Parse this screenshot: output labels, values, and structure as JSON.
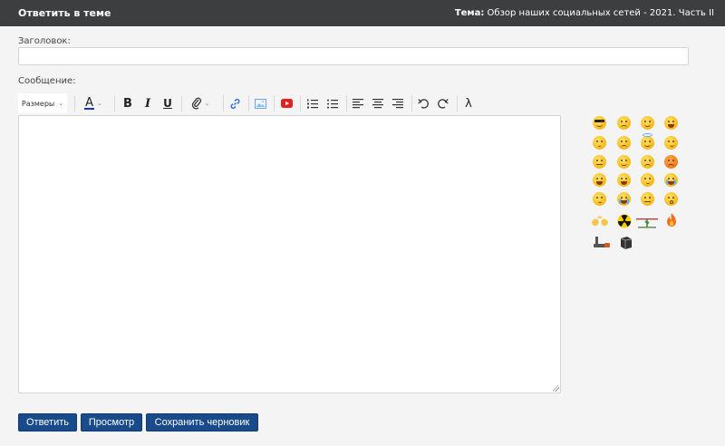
{
  "header": {
    "title": "Ответить в теме",
    "topic_label": "Тема:",
    "topic_value": "Обзор наших социальных сетей - 2021. Часть II"
  },
  "form": {
    "subject_label": "Заголовок:",
    "subject_value": "",
    "message_label": "Сообщение:",
    "message_value": ""
  },
  "toolbar": {
    "sizes_label": "Размеры",
    "font_color_letter": "A",
    "bold_letter": "B",
    "italic_letter": "I",
    "underline_letter": "U",
    "lambda_symbol": "λ",
    "icons": [
      "chevron-down-icon",
      "font-color-icon",
      "bold-icon",
      "italic-icon",
      "underline-icon",
      "attachment-icon",
      "link-icon",
      "image-icon",
      "youtube-icon",
      "ordered-list-icon",
      "unordered-list-icon",
      "align-left-icon",
      "align-center-icon",
      "align-right-icon",
      "undo-icon",
      "redo-icon",
      "lambda-icon"
    ]
  },
  "smileys": {
    "items": [
      "sunglasses-smiley-icon",
      "sad-sweat-smiley-icon",
      "smile-smiley-icon",
      "grin-smiley-icon",
      "blush-smiley-icon",
      "worried-smiley-icon",
      "angel-smiley-icon",
      "smirk-smiley-icon",
      "unamused-smiley-icon",
      "relieved-smiley-icon",
      "frown-smiley-icon",
      "angry-smiley-icon",
      "sweat-laugh-smiley-icon",
      "laugh-smiley-icon",
      "pensive-smiley-icon",
      "crying-smiley-icon",
      "sleepy-smiley-icon",
      "tears-of-joy-smiley-icon",
      "neutral-smiley-icon",
      "astonished-smiley-icon",
      "clapping-hands-icon",
      "radioactive-icon",
      "cactus-scene-icon",
      "fire-icon",
      "gun-icon",
      "book-icon"
    ]
  },
  "actions": {
    "reply_label": "Ответить",
    "preview_label": "Просмотр",
    "save_draft_label": "Сохранить черновик"
  },
  "colors": {
    "header_bg": "#3d3e40",
    "button_bg": "#194a8a",
    "font_color_underline": "#1f2fd0",
    "youtube_red": "#e32020"
  }
}
